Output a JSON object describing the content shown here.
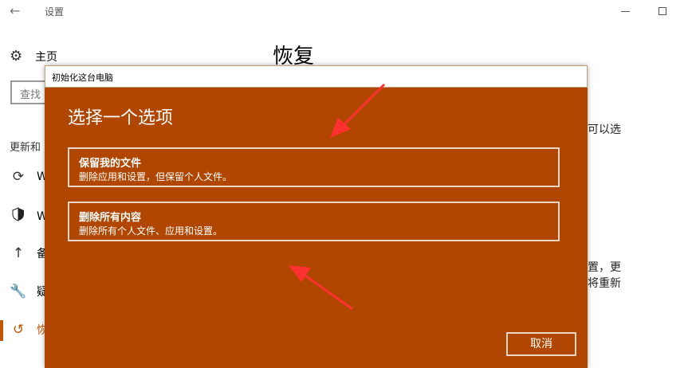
{
  "window": {
    "app_title": "设置",
    "back_icon": "←",
    "home_label": "主页",
    "search_placeholder": "查找",
    "section_label": "更新和",
    "nav": [
      {
        "icon": "sync-icon",
        "label": "W"
      },
      {
        "icon": "shield-icon",
        "label": "W"
      },
      {
        "icon": "upload-icon",
        "label": "备"
      },
      {
        "icon": "wrench-icon",
        "label": "疑"
      },
      {
        "icon": "history-icon",
        "label": "恢"
      }
    ],
    "page_title": "恢复",
    "right_text": [
      "可以选",
      "置，更",
      "将重新"
    ]
  },
  "dialog": {
    "title": "初始化这台电脑",
    "heading": "选择一个选项",
    "options": [
      {
        "title": "保留我的文件",
        "desc": "删除应用和设置，但保留个人文件。"
      },
      {
        "title": "删除所有内容",
        "desc": "删除所有个人文件、应用和设置。"
      }
    ],
    "cancel": "取消"
  },
  "colors": {
    "accent": "#b04600",
    "annotation": "#ff3030"
  }
}
